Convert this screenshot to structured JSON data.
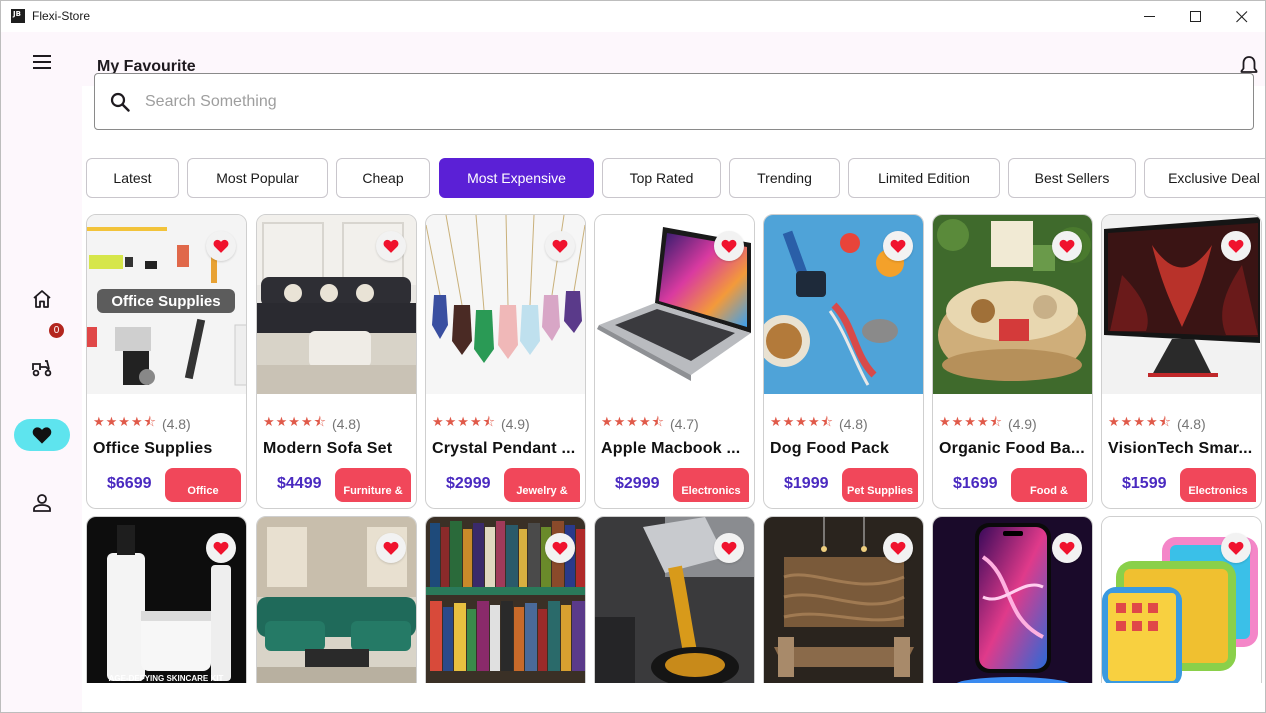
{
  "window": {
    "logo_text": "JB",
    "title": "Flexi-Store"
  },
  "header": {
    "title": "My Favourite"
  },
  "search": {
    "placeholder": "Search Something",
    "value": ""
  },
  "filters": [
    {
      "label": "Latest",
      "active": false
    },
    {
      "label": "Most Popular",
      "active": false
    },
    {
      "label": "Cheap",
      "active": false
    },
    {
      "label": "Most Expensive",
      "active": true
    },
    {
      "label": "Top Rated",
      "active": false
    },
    {
      "label": "Trending",
      "active": false
    },
    {
      "label": "Limited Edition",
      "active": false
    },
    {
      "label": "Best Sellers",
      "active": false
    },
    {
      "label": "Exclusive Deal",
      "active": false
    }
  ],
  "sidebar": {
    "cart_badge": "0",
    "items": [
      "home",
      "delivery",
      "favourites",
      "profile"
    ],
    "active": "favourites"
  },
  "products": [
    {
      "name": "Office Supplies",
      "rating": "(4.8)",
      "price": "$6699",
      "category": "Office",
      "image": "office-supplies-image",
      "image_caption": "Office Supplies"
    },
    {
      "name": "Modern Sofa Set",
      "rating": "(4.8)",
      "price": "$4499",
      "category": "Furniture &",
      "image": "sofa-image"
    },
    {
      "name": "Crystal Pendant ...",
      "rating": "(4.9)",
      "price": "$2999",
      "category": "Jewelry &",
      "image": "pendant-image"
    },
    {
      "name": "Apple Macbook ...",
      "rating": "(4.7)",
      "price": "$2999",
      "category": "Electronics",
      "image": "laptop-image"
    },
    {
      "name": "Dog Food Pack",
      "rating": "(4.8)",
      "price": "$1999",
      "category": "Pet Supplies",
      "image": "dog-toys-image"
    },
    {
      "name": "Organic Food Ba...",
      "rating": "(4.9)",
      "price": "$1699",
      "category": "Food &",
      "image": "food-basket-image"
    },
    {
      "name": "VisionTech Smar...",
      "rating": "(4.8)",
      "price": "$1599",
      "category": "Electronics",
      "image": "monitor-image"
    }
  ],
  "products_row2": [
    {
      "image": "skincare-image",
      "image_caption": "AGE-DEFYING SKINCARE KIT"
    },
    {
      "image": "living-room-image"
    },
    {
      "image": "books-image"
    },
    {
      "image": "engine-oil-image"
    },
    {
      "image": "dining-room-image"
    },
    {
      "image": "smartphone-image"
    },
    {
      "image": "kids-tablet-image"
    }
  ],
  "colors": {
    "accent": "#5b20d6",
    "price": "#4a2ac0",
    "tag": "#f1475a",
    "heart": "#f0132e",
    "star": "#e05a4a",
    "active_nav": "#5ee4ee",
    "badge": "#b3261e"
  }
}
